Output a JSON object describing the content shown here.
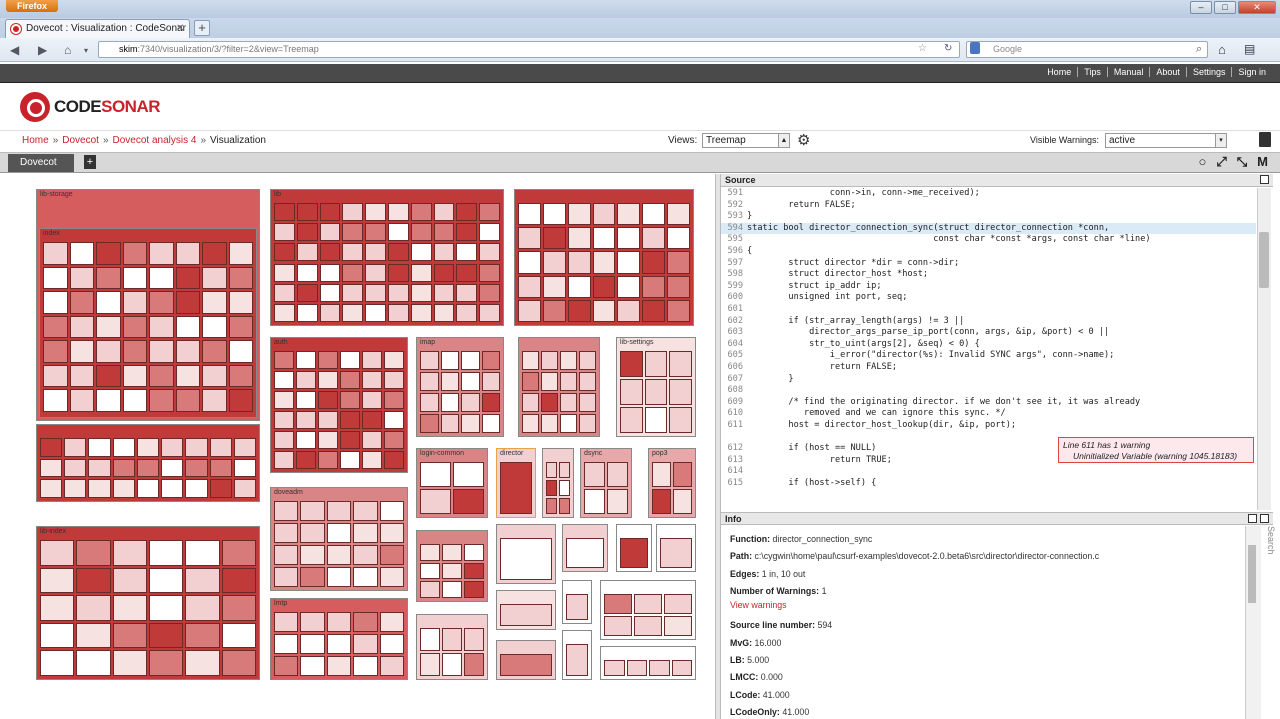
{
  "browser": {
    "app_button": "Firefox",
    "tab_title": "Dovecot : Visualization : CodeSonar",
    "url_host": "skim",
    "url_rest": ":7340/visualization/3/?filter=2&view=Treemap",
    "search_placeholder": "Google",
    "window_controls": [
      "–",
      "□",
      "✕"
    ]
  },
  "topnav": [
    "Home",
    "Tips",
    "Manual",
    "About",
    "Settings",
    "Sign in"
  ],
  "logo": {
    "code": "CODE",
    "sonar": "SONAR"
  },
  "breadcrumb": {
    "home": "Home",
    "project": "Dovecot",
    "analysis": "Dovecot analysis 4",
    "current": "Visualization",
    "sep": "»"
  },
  "views": {
    "label": "Views:",
    "value": "Treemap"
  },
  "visible_warnings": {
    "label": "Visible Warnings:",
    "value": "active"
  },
  "vis_tab": {
    "label": "Dovecot",
    "add": "+"
  },
  "toolbar_icons": [
    "circle-icon",
    "expand-icon",
    "collapse-icon",
    "m-icon"
  ],
  "toolbar_glyphs": [
    "○",
    "⤢",
    "⤡",
    "M"
  ],
  "treemap": {
    "labels": [
      "lib-storage",
      "index",
      "lib",
      "lib-index",
      "auth",
      "doveadm",
      "lmtp",
      "imap",
      "login-common",
      "director",
      "dsync",
      "pop3",
      "lib-settings"
    ]
  },
  "source": {
    "title": "Source",
    "lines": [
      {
        "n": "591",
        "t": "                conn->in, conn->me_received);"
      },
      {
        "n": "592",
        "t": "        return FALSE;"
      },
      {
        "n": "593",
        "t": "}"
      },
      {
        "n": "594",
        "t": "static bool director_connection_sync(struct director_connection *conn,",
        "hl": true
      },
      {
        "n": "595",
        "t": "                                    const char *const *args, const char *line)"
      },
      {
        "n": "596",
        "t": "{"
      },
      {
        "n": "597",
        "t": "        struct director *dir = conn->dir;"
      },
      {
        "n": "598",
        "t": "        struct director_host *host;"
      },
      {
        "n": "599",
        "t": "        struct ip_addr ip;"
      },
      {
        "n": "600",
        "t": "        unsigned int port, seq;"
      },
      {
        "n": "601",
        "t": ""
      },
      {
        "n": "602",
        "t": "        if (str_array_length(args) != 3 ||"
      },
      {
        "n": "603",
        "t": "            director_args_parse_ip_port(conn, args, &ip, &port) < 0 ||"
      },
      {
        "n": "604",
        "t": "            str_to_uint(args[2], &seq) < 0) {"
      },
      {
        "n": "605",
        "t": "                i_error(\"director(%s): Invalid SYNC args\", conn->name);"
      },
      {
        "n": "606",
        "t": "                return FALSE;"
      },
      {
        "n": "607",
        "t": "        }"
      },
      {
        "n": "608",
        "t": ""
      },
      {
        "n": "609",
        "t": "        /* find the originating director. if we don't see it, it was already"
      },
      {
        "n": "610",
        "t": "           removed and we can ignore this sync. */"
      },
      {
        "n": "611",
        "t": "        host = director_host_lookup(dir, &ip, port);"
      },
      {
        "n": "",
        "t": ""
      },
      {
        "n": "612",
        "t": "        if (host == NULL)"
      },
      {
        "n": "613",
        "t": "                return TRUE;"
      },
      {
        "n": "614",
        "t": ""
      },
      {
        "n": "615",
        "t": "        if (host->self) {"
      }
    ],
    "warning": {
      "line1": "Line 611 has 1 warning",
      "line2": "Uninitialized Variable (warning 1045.18183)"
    }
  },
  "info": {
    "title": "Info",
    "function": {
      "label": "Function:",
      "value": "director_connection_sync"
    },
    "path": {
      "label": "Path:",
      "value": "c:\\cygwin\\home\\paul\\csurf-examples\\dovecot-2.0.beta6\\src\\director\\director-connection.c"
    },
    "edges": {
      "label": "Edges:",
      "value": "1 in, 10 out"
    },
    "warnings": {
      "label": "Number of Warnings:",
      "value": "1"
    },
    "view_warnings": "View warnings",
    "source_line": {
      "label": "Source line number:",
      "value": "594"
    },
    "mvg": {
      "label": "MvG:",
      "value": "16.000"
    },
    "lb": {
      "label": "LB:",
      "value": "5.000"
    },
    "lmcc": {
      "label": "LMCC:",
      "value": "0.000"
    },
    "lcode": {
      "label": "LCode:",
      "value": "41.000"
    },
    "lcodeonly": {
      "label": "LCodeOnly:",
      "value": "41.000"
    },
    "search_side": "Search"
  },
  "colors": {
    "accent": "#c8232a",
    "tile_dark": "#c13a3a",
    "tile_mid": "#d97a7a",
    "tile_light": "#f2cfd0"
  }
}
